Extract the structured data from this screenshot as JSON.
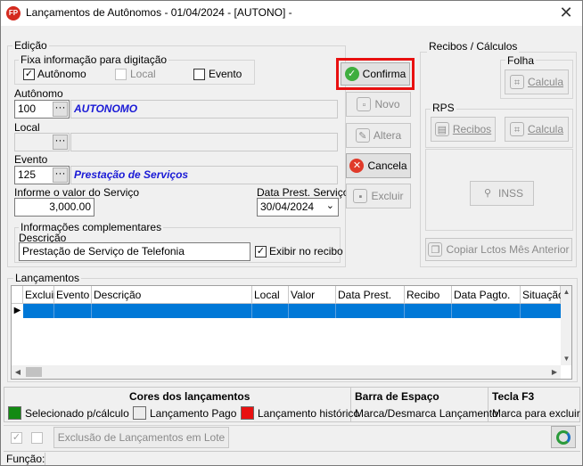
{
  "window": {
    "title": "Lançamentos de Autônomos -  01/04/2024 - [AUTONO] -",
    "app_icon": "FP",
    "close_glyph": "✕"
  },
  "edicao": {
    "group_label": "Edição",
    "fixa_label": "Fixa informação para digitação",
    "fixa_options": [
      {
        "label": "Autônomo",
        "checked": true,
        "enabled": true
      },
      {
        "label": "Local",
        "checked": false,
        "enabled": false
      },
      {
        "label": "Evento",
        "checked": false,
        "enabled": true
      }
    ],
    "autonomo_label": "Autônomo",
    "autonomo_code": "100",
    "autonomo_name": "AUTONOMO",
    "local_label": "Local",
    "local_code": "",
    "local_name": "",
    "evento_label": "Evento",
    "evento_code": "125",
    "evento_name": "Prestação de Serviços",
    "valor_label": "Informe o valor do Serviço",
    "valor": "3,000.00",
    "data_label": "Data Prest. Serviço",
    "data": "30/04/2024",
    "info_label": "Informações complementares",
    "descricao_label": "Descrição",
    "descricao": "Prestação de Serviço de Telefonia",
    "exibir_label": "Exibir no recibo",
    "exibir_checked": true,
    "dots_glyph": "···"
  },
  "actions": {
    "confirma": "Confirma",
    "novo": "Novo",
    "altera": "Altera",
    "cancela": "Cancela",
    "excluir": "Excluir"
  },
  "recibos": {
    "group_label": "Recibos / Cálculos",
    "folha_label": "Folha",
    "folha_calcula": "Calcula",
    "rps_label": "RPS",
    "rps_recibos": "Recibos",
    "rps_calcula": "Calcula",
    "inss": "INSS",
    "copiar": "Copiar Lctos Mês Anterior"
  },
  "lancamentos": {
    "group_label": "Lançamentos",
    "columns": [
      "Excluir",
      "Evento",
      "Descrição",
      "Local",
      "Valor",
      "Data Prest.",
      "Recibo",
      "Data Pagto.",
      "Situação"
    ],
    "row_marker": "▶",
    "scroll_up": "▲",
    "scroll_down": "▼",
    "scroll_left": "◀",
    "scroll_right": "▶"
  },
  "legend": {
    "cores_title": "Cores dos lançamentos",
    "selecionado": "Selecionado p/cálculo",
    "pago": "Lançamento Pago",
    "historico": "Lançamento histórico",
    "barra_title": "Barra de Espaço",
    "barra_text": "Marca/Desmarca Lançamento",
    "tecla_title": "Tecla F3",
    "tecla_text": "Marca para excluir",
    "colors": {
      "selecionado": "#138a13",
      "pago": "#ececec",
      "historico": "#e81010"
    }
  },
  "bottom": {
    "exclusao_lote": "Exclusão de Lançamentos em Lote",
    "funcao_label": "Função:"
  },
  "colors": {
    "selection": "#0078d7",
    "highlight": "#e81010"
  }
}
